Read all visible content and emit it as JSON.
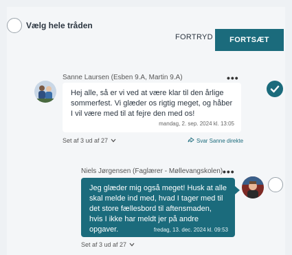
{
  "toolbar": {
    "select_all_label": "Vælg hele tråden",
    "cancel_label": "FORTRYD",
    "continue_label": "FORTSÆT"
  },
  "messages": [
    {
      "author": "Sanne Laursen (Esben 9.A, Martin 9.A)",
      "more": "•••",
      "text": "Hej alle, så er vi ved at være klar til den årlige sommerfest. Vi glæder os rigtig meget, og håber I vil være med til at fejre den med os!",
      "timestamp": "mandag, 2. sep. 2024 kl. 13:05",
      "seen_by": "Set af 3 ud af 27",
      "reply_label": "Svar Sanne direkte",
      "selected": true
    },
    {
      "author": "Niels Jørgensen (Faglærer - Møllevangskolen)",
      "more": "•••",
      "text": "Jeg glæder mig også meget! Husk at alle skal melde ind med, hvad I tager med til det store fællesbord til aftensmaden, hvis I ikke har meldt jer på andre opgaver.",
      "timestamp": "fredag, 13. dec. 2024 kl. 09:53",
      "seen_by": "Set af 3 ud af 27",
      "selected": false
    }
  ],
  "colors": {
    "accent": "#1b6b7c",
    "background": "#f4f6f8",
    "bubble_white": "#ffffff"
  }
}
